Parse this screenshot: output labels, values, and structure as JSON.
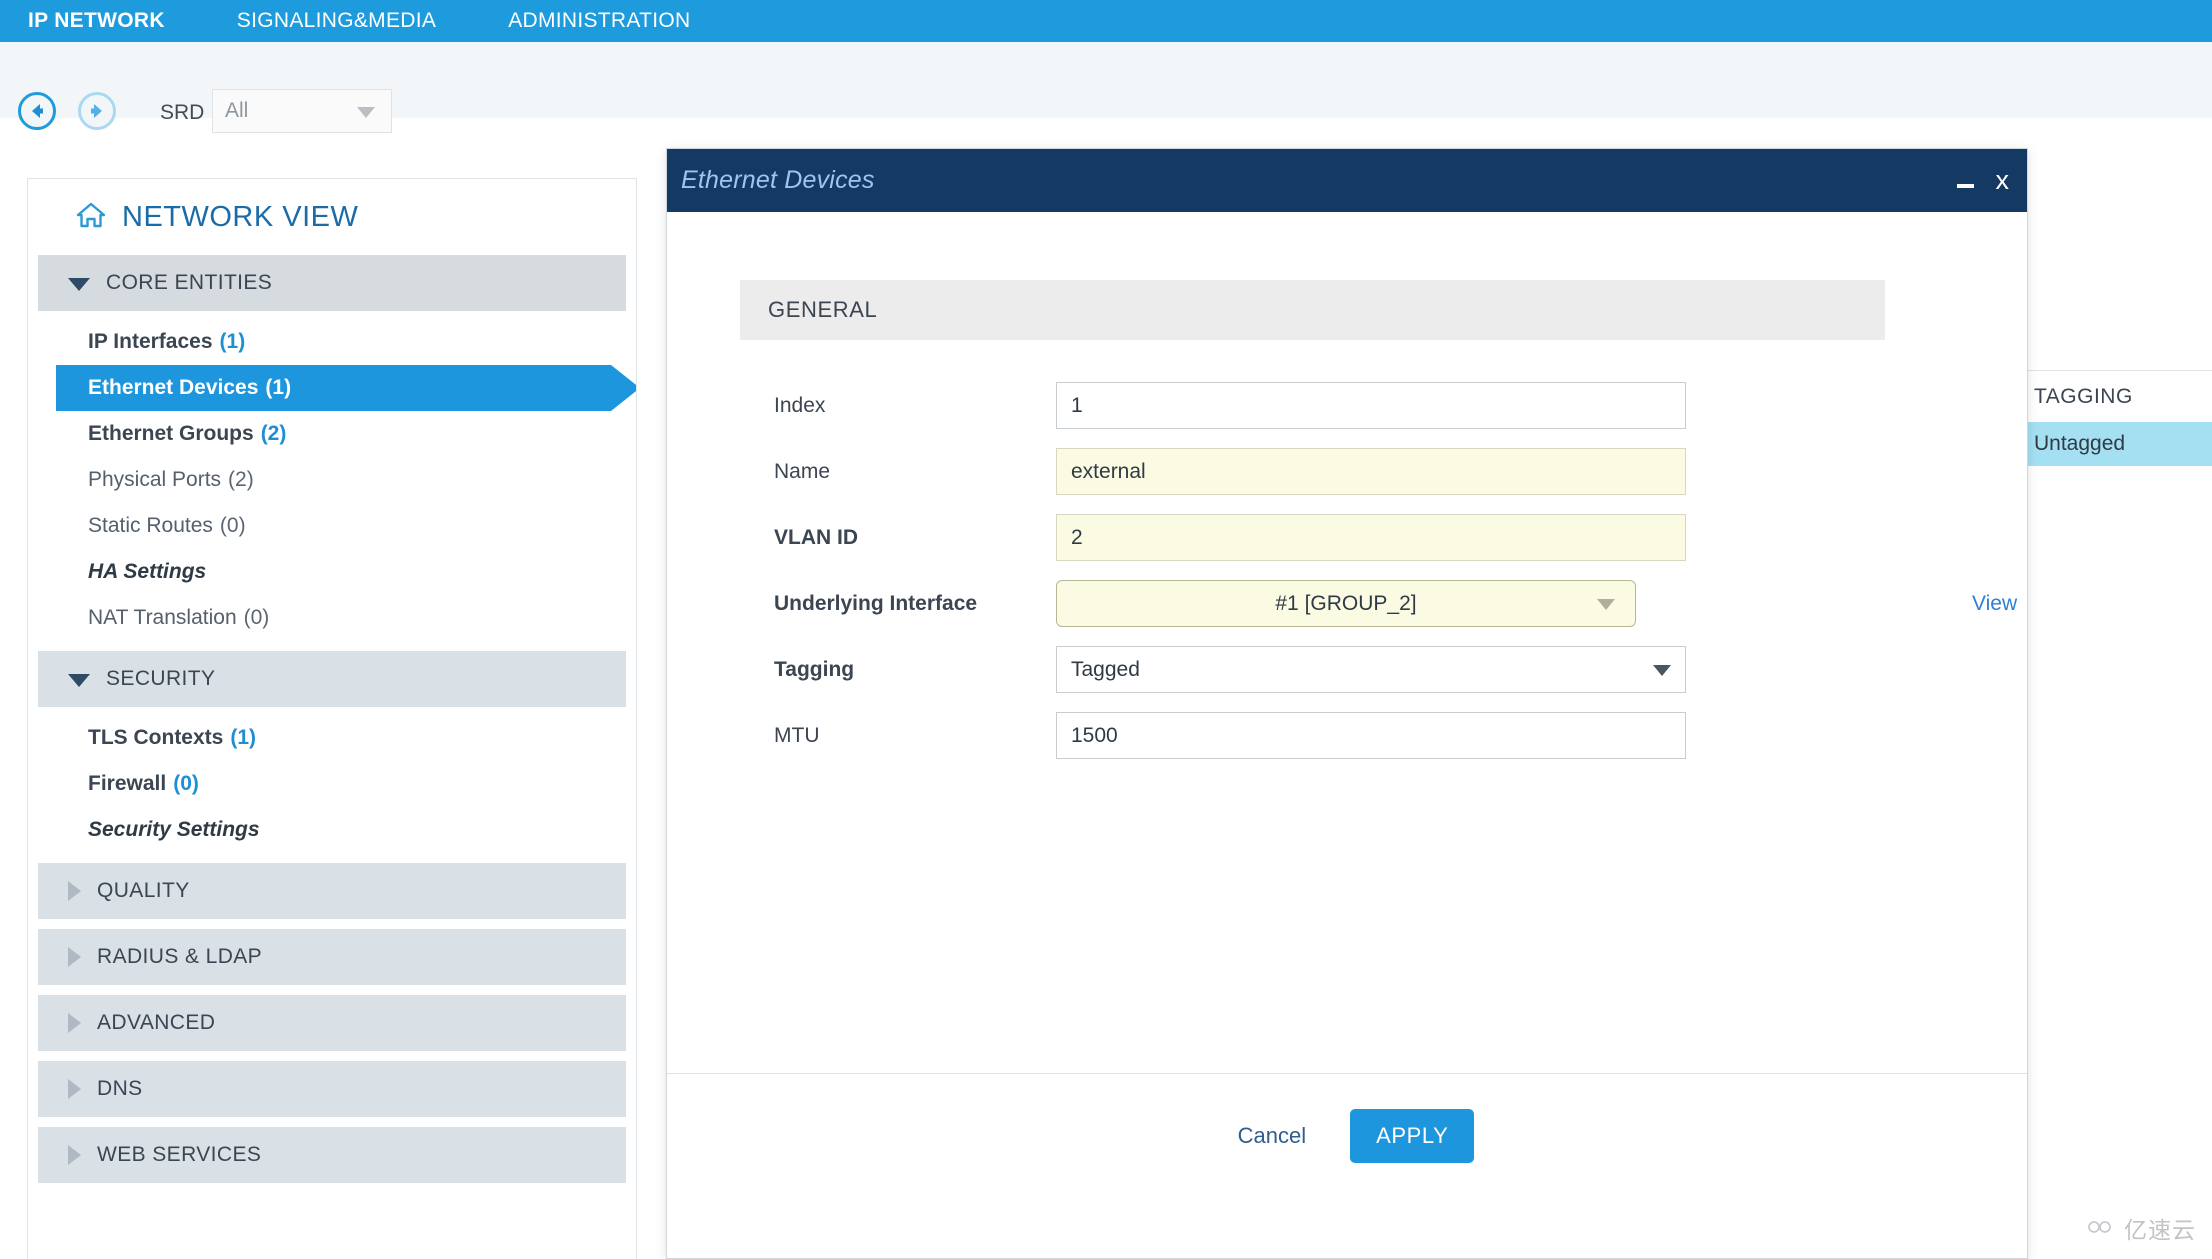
{
  "topnav": {
    "tabs": [
      {
        "label": "IP NETWORK",
        "active": true
      },
      {
        "label": "SIGNALING&MEDIA",
        "active": false
      },
      {
        "label": "ADMINISTRATION",
        "active": false
      }
    ]
  },
  "toolbar": {
    "back_icon": "arrow-left-icon",
    "forward_icon": "arrow-right-icon",
    "srd_label": "SRD",
    "srd_value": "All"
  },
  "sidebar": {
    "home_icon": "home-icon",
    "title": "NETWORK VIEW",
    "groups": [
      {
        "label": "CORE ENTITIES",
        "expanded": true,
        "items": [
          {
            "label": "IP Interfaces",
            "count": "(1)",
            "style": "bold"
          },
          {
            "label": "Ethernet Devices",
            "count": "(1)",
            "style": "selected"
          },
          {
            "label": "Ethernet Groups",
            "count": "(2)",
            "style": "bold"
          },
          {
            "label": "Physical Ports",
            "count": "(2)",
            "style": "dim"
          },
          {
            "label": "Static Routes",
            "count": "(0)",
            "style": "dim"
          },
          {
            "label": "HA Settings",
            "count": "",
            "style": "italic"
          },
          {
            "label": "NAT Translation",
            "count": "(0)",
            "style": "dim"
          }
        ]
      },
      {
        "label": "SECURITY",
        "expanded": true,
        "items": [
          {
            "label": "TLS Contexts",
            "count": "(1)",
            "style": "bold"
          },
          {
            "label": "Firewall",
            "count": "(0)",
            "style": "bold"
          },
          {
            "label": "Security Settings",
            "count": "",
            "style": "italic"
          }
        ]
      },
      {
        "label": "QUALITY",
        "expanded": false,
        "items": []
      },
      {
        "label": "RADIUS & LDAP",
        "expanded": false,
        "items": []
      },
      {
        "label": "ADVANCED",
        "expanded": false,
        "items": []
      },
      {
        "label": "DNS",
        "expanded": false,
        "items": []
      },
      {
        "label": "WEB SERVICES",
        "expanded": false,
        "items": []
      }
    ]
  },
  "background_table": {
    "column_header": "TAGGING",
    "selected_row": "Untagged"
  },
  "dialog": {
    "title": "Ethernet Devices",
    "minimize_icon": "minimize-icon",
    "close_icon": "close-icon",
    "close_label": "x",
    "section_title": "GENERAL",
    "fields": [
      {
        "label": "Index",
        "value": "1",
        "type": "text",
        "highlight": false,
        "required": false
      },
      {
        "label": "Name",
        "value": "external",
        "type": "text",
        "highlight": true,
        "required": false
      },
      {
        "label": "VLAN ID",
        "value": "2",
        "type": "text",
        "highlight": true,
        "required": true
      },
      {
        "label": "Underlying Interface",
        "value": "#1 [GROUP_2]",
        "type": "select-round",
        "highlight": true,
        "required": true,
        "link": "View"
      },
      {
        "label": "Tagging",
        "value": "Tagged",
        "type": "select",
        "highlight": false,
        "required": true
      },
      {
        "label": "MTU",
        "value": "1500",
        "type": "text",
        "highlight": false,
        "required": false
      }
    ],
    "cancel_label": "Cancel",
    "apply_label": "APPLY"
  },
  "watermark": {
    "icon": "cloud-icon",
    "text": "亿速云"
  },
  "colors": {
    "brand_blue": "#1d9bdd",
    "dialog_navy": "#143a63",
    "accent_link": "#2f7fd4",
    "highlight_yellow": "#fbfbe3",
    "row_select_cyan": "#a4e0f2"
  }
}
